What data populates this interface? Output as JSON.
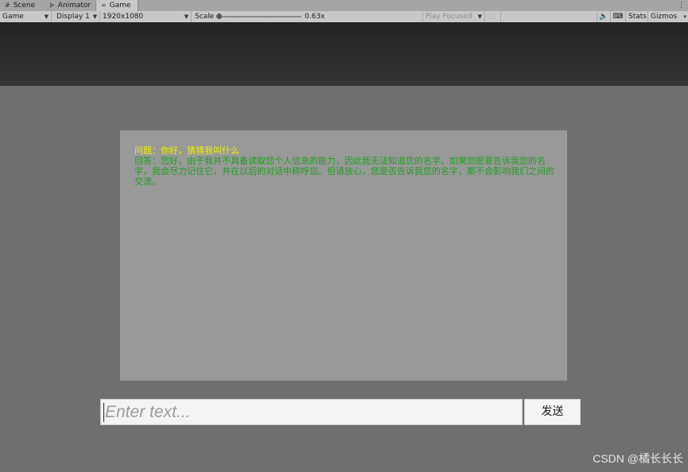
{
  "tabs": [
    {
      "label": "Scene",
      "icon": "grid-icon"
    },
    {
      "label": "Animator",
      "icon": "animator-icon"
    },
    {
      "label": "Game",
      "icon": "gamepad-icon"
    }
  ],
  "toolbar": {
    "game_mode": "Game",
    "display": "Display 1",
    "resolution": "1920x1080",
    "scale_label": "Scale",
    "scale_value": "0.63x",
    "play_mode": "Play Focused",
    "stats": "Stats",
    "gizmos": "Gizmos"
  },
  "chat": {
    "question": "问题：你好，猜猜我叫什么",
    "answer": "回答：您好，由于我并不具备读取您个人信息的能力，因此我无法知道您的名字。如果您愿意告诉我您的名字，我会尽力记住它，并在以后的对话中称呼您。但请放心，您是否告诉我您的名字，都不会影响我们之间的交流。"
  },
  "input": {
    "placeholder": "Enter text..."
  },
  "send_button": "发送",
  "watermark": "CSDN @橘长长长",
  "colors": {
    "question": "#f0f000",
    "answer": "#1f9f1f",
    "panel": "#999999",
    "background": "#6f6f6f"
  }
}
